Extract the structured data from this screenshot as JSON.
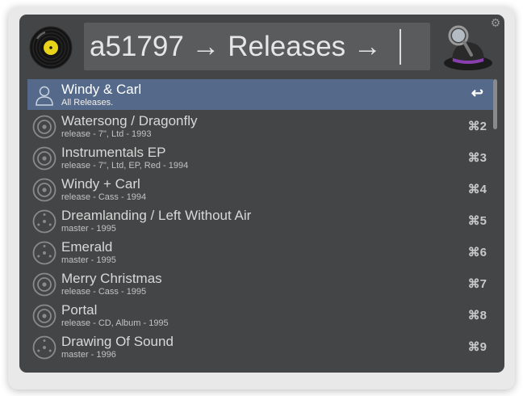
{
  "search": {
    "query": "a51797 → Releases →"
  },
  "icons": {
    "left": "vinyl-record-icon",
    "right": "alfred-hat-icon",
    "settings": "gear-icon"
  },
  "results": [
    {
      "title": "Windy & Carl",
      "subtitle": "All Releases.",
      "shortcut": "↩",
      "icon": "user-icon",
      "selected": true
    },
    {
      "title": "Watersong / Dragonfly",
      "subtitle": "release - 7\", Ltd - 1993",
      "shortcut": "⌘2",
      "icon": "release-disc-icon"
    },
    {
      "title": "Instrumentals EP",
      "subtitle": "release - 7\", Ltd, EP, Red - 1994",
      "shortcut": "⌘3",
      "icon": "release-disc-icon"
    },
    {
      "title": "Windy + Carl",
      "subtitle": "release - Cass - 1994",
      "shortcut": "⌘4",
      "icon": "release-disc-icon"
    },
    {
      "title": "Dreamlanding / Left Without Air",
      "subtitle": "master - 1995",
      "shortcut": "⌘5",
      "icon": "master-disc-icon"
    },
    {
      "title": "Emerald",
      "subtitle": "master - 1995",
      "shortcut": "⌘6",
      "icon": "master-disc-icon"
    },
    {
      "title": "Merry Christmas",
      "subtitle": "release - Cass - 1995",
      "shortcut": "⌘7",
      "icon": "release-disc-icon"
    },
    {
      "title": "Portal",
      "subtitle": "release - CD, Album - 1995",
      "shortcut": "⌘8",
      "icon": "release-disc-icon"
    },
    {
      "title": "Drawing Of Sound",
      "subtitle": "master - 1996",
      "shortcut": "⌘9",
      "icon": "master-disc-icon"
    }
  ],
  "colors": {
    "window_bg": "#444546",
    "selected_row": "#55698a",
    "search_bg": "#5a5b5c"
  }
}
